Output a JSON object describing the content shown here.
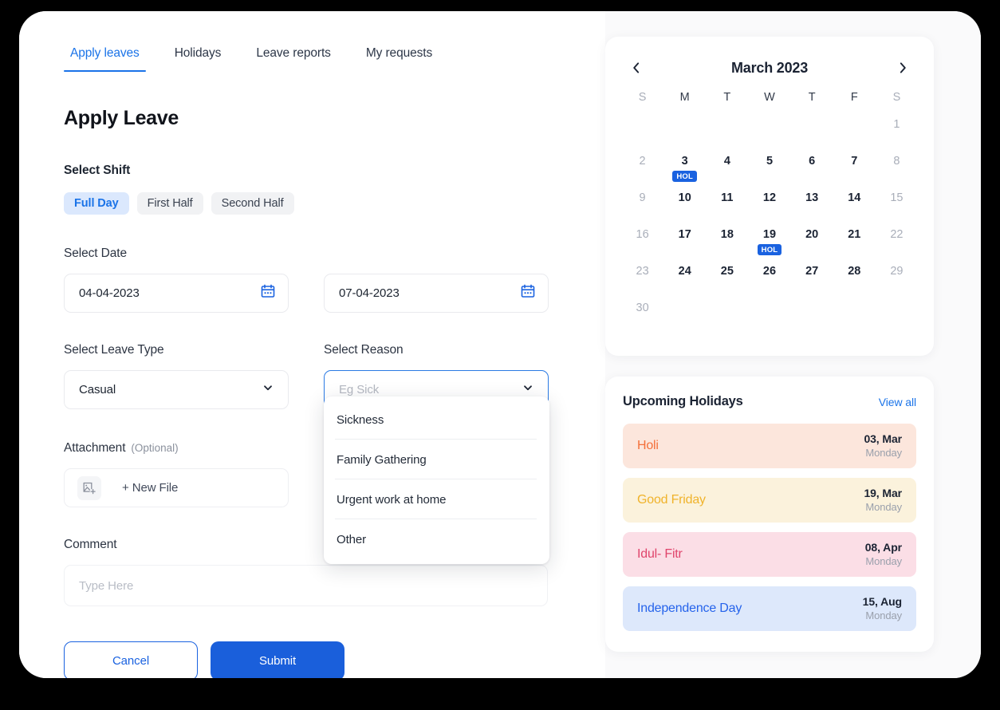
{
  "tabs": [
    {
      "label": "Apply leaves",
      "active": true
    },
    {
      "label": "Holidays",
      "active": false
    },
    {
      "label": "Leave reports",
      "active": false
    },
    {
      "label": "My requests",
      "active": false
    }
  ],
  "page_title": "Apply Leave",
  "shift": {
    "label": "Select Shift",
    "options": [
      {
        "label": "Full Day",
        "selected": true
      },
      {
        "label": "First Half",
        "selected": false
      },
      {
        "label": "Second Half",
        "selected": false
      }
    ]
  },
  "date": {
    "label": "Select Date",
    "from_value": "04-04-2023",
    "to_value": "07-04-2023",
    "icon": "calendar-icon"
  },
  "leave_type": {
    "label": "Select Leave Type",
    "value": "Casual",
    "icon": "chevron-down-icon"
  },
  "reason": {
    "label": "Select Reason",
    "placeholder": "Eg Sick",
    "value": "",
    "icon": "chevron-down-icon",
    "dropdown_open": true,
    "options": [
      "Sickness",
      "Family Gathering",
      "Urgent work at home",
      "Other"
    ]
  },
  "attachment": {
    "label": "Attachment",
    "optional_note": "(Optional)",
    "button_label": "+ New File",
    "icon": "image-add-icon"
  },
  "comment": {
    "label": "Comment",
    "placeholder": "Type Here",
    "value": ""
  },
  "actions": {
    "cancel_label": "Cancel",
    "submit_label": "Submit"
  },
  "calendar": {
    "title": "March 2023",
    "prev_icon": "chevron-left-icon",
    "next_icon": "chevron-right-icon",
    "weekdays": [
      {
        "label": "S",
        "dim": true
      },
      {
        "label": "M",
        "dim": false
      },
      {
        "label": "T",
        "dim": false
      },
      {
        "label": "W",
        "dim": false
      },
      {
        "label": "T",
        "dim": false
      },
      {
        "label": "F",
        "dim": false
      },
      {
        "label": "S",
        "dim": true
      }
    ],
    "leading_blanks": 6,
    "badge_label": "HOL",
    "days": [
      {
        "num": "1",
        "weekend": true,
        "holiday": false
      },
      {
        "num": "2",
        "weekend": true,
        "holiday": false
      },
      {
        "num": "3",
        "weekend": false,
        "holiday": true
      },
      {
        "num": "4",
        "weekend": false,
        "holiday": false
      },
      {
        "num": "5",
        "weekend": false,
        "holiday": false
      },
      {
        "num": "6",
        "weekend": false,
        "holiday": false
      },
      {
        "num": "7",
        "weekend": false,
        "holiday": false
      },
      {
        "num": "8",
        "weekend": true,
        "holiday": false
      },
      {
        "num": "9",
        "weekend": true,
        "holiday": false
      },
      {
        "num": "10",
        "weekend": false,
        "holiday": false
      },
      {
        "num": "11",
        "weekend": false,
        "holiday": false
      },
      {
        "num": "12",
        "weekend": false,
        "holiday": false
      },
      {
        "num": "13",
        "weekend": false,
        "holiday": false
      },
      {
        "num": "14",
        "weekend": false,
        "holiday": false
      },
      {
        "num": "15",
        "weekend": true,
        "holiday": false
      },
      {
        "num": "16",
        "weekend": true,
        "holiday": false
      },
      {
        "num": "17",
        "weekend": false,
        "holiday": false
      },
      {
        "num": "18",
        "weekend": false,
        "holiday": false
      },
      {
        "num": "19",
        "weekend": false,
        "holiday": true
      },
      {
        "num": "20",
        "weekend": false,
        "holiday": false
      },
      {
        "num": "21",
        "weekend": false,
        "holiday": false
      },
      {
        "num": "22",
        "weekend": true,
        "holiday": false
      },
      {
        "num": "23",
        "weekend": true,
        "holiday": false
      },
      {
        "num": "24",
        "weekend": false,
        "holiday": false
      },
      {
        "num": "25",
        "weekend": false,
        "holiday": false
      },
      {
        "num": "26",
        "weekend": false,
        "holiday": false
      },
      {
        "num": "27",
        "weekend": false,
        "holiday": false
      },
      {
        "num": "28",
        "weekend": false,
        "holiday": false
      },
      {
        "num": "29",
        "weekend": true,
        "holiday": false
      },
      {
        "num": "30",
        "weekend": true,
        "holiday": false
      }
    ]
  },
  "upcoming_holidays": {
    "title": "Upcoming Holidays",
    "view_all_label": "View all",
    "items": [
      {
        "name": "Holi",
        "date": "03, Mar",
        "day": "Monday",
        "bg": "#fce6dc",
        "color": "#f4703a"
      },
      {
        "name": "Good Friday",
        "date": "19, Mar",
        "day": "Monday",
        "bg": "#fbf2dc",
        "color": "#f0b32b"
      },
      {
        "name": "Idul- Fitr",
        "date": "08, Apr",
        "day": "Monday",
        "bg": "#fbdee6",
        "color": "#e0456c"
      },
      {
        "name": "Independence Day",
        "date": "15, Aug",
        "day": "Monday",
        "bg": "#dde8fb",
        "color": "#2563eb"
      }
    ]
  },
  "theme": {
    "accent_blue": "#1a73e8",
    "submit_blue": "#1a5fdb",
    "badge_blue": "#1a62e0"
  }
}
